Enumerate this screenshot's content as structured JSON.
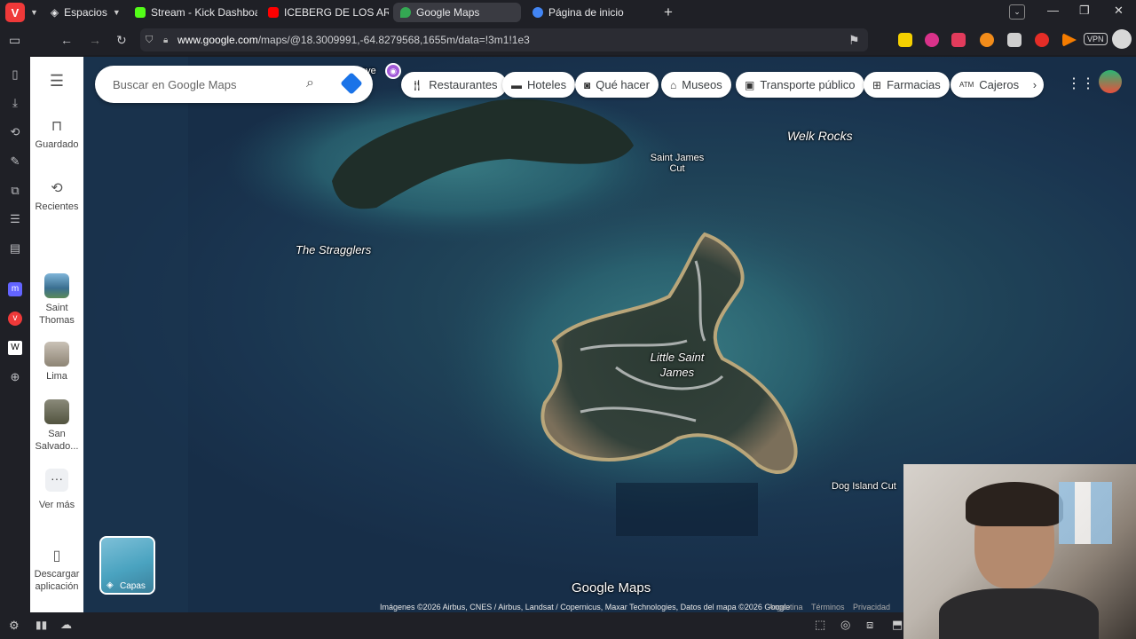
{
  "browser": {
    "spaces_label": "Espacios",
    "tabs": [
      {
        "label": "Stream - Kick Dashboard",
        "favicon_color": "#53fc18"
      },
      {
        "label": "ICEBERG DE LOS ARCHIVOS",
        "favicon_color": "#ff0000"
      },
      {
        "label": "Google Maps",
        "favicon_color": "#34a853"
      },
      {
        "label": "Página de inicio",
        "favicon_color": "#4285f4"
      }
    ],
    "active_tab": 2,
    "url_domain": "www.google.com",
    "url_path": "/maps/@18.3009991,-64.8279568,1655m/data=!3m1!1e3",
    "vpn_label": "VPN"
  },
  "maps_rail": {
    "saved": "Guardado",
    "recent": "Recientes",
    "recent_places": [
      {
        "label": "Saint Thomas"
      },
      {
        "label": "Lima"
      },
      {
        "label": "San Salvado..."
      }
    ],
    "more": "Ver más",
    "download": "Descargar aplicación"
  },
  "search": {
    "placeholder": "Buscar en Google Maps"
  },
  "chips": [
    {
      "label": "Restaurantes",
      "icon": "fork-knife-icon"
    },
    {
      "label": "Hoteles",
      "icon": "bed-icon"
    },
    {
      "label": "Qué hacer",
      "icon": "camera-icon"
    },
    {
      "label": "Museos",
      "icon": "museum-icon"
    },
    {
      "label": "Transporte público",
      "icon": "bus-icon"
    },
    {
      "label": "Farmacias",
      "icon": "pharmacy-icon"
    },
    {
      "label": "Cajeros",
      "icon": "atm-icon"
    }
  ],
  "map_labels": {
    "welk_rocks": "Welk Rocks",
    "saint_james_cut": "Saint James Cut",
    "stragglers": "The Stragglers",
    "little_saint_james": "Little Saint James",
    "dog_island_cut": "Dog Island Cut",
    "cove_fragment": "ove"
  },
  "layers_label": "Capas",
  "brand": "Google Maps",
  "attribution": "Imágenes ©2026 Airbus, CNES / Airbus, Landsat / Copernicus, Maxar Technologies, Datos del mapa ©2026 Google",
  "footer_links": [
    "Argentina",
    "Términos",
    "Privacidad"
  ]
}
